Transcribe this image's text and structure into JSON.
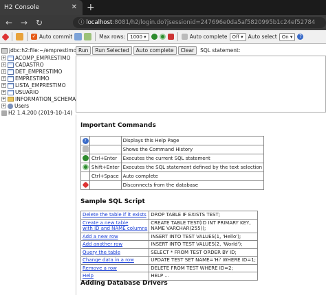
{
  "browser": {
    "tab_title": "H2 Console",
    "tab_close": "✕",
    "new_tab": "+",
    "url_host": "localhost",
    "url_rest": ":8081/h2/login.do?jsessionid=247696e0da5af5820995b1c24ef52784"
  },
  "toolbar": {
    "auto_commit_label": "Auto commit",
    "max_rows_label": "Max rows:",
    "max_rows_value": "1000",
    "auto_complete_label": "Auto complete",
    "auto_complete_value": "Off",
    "auto_select_label": "Auto select",
    "auto_select_value": "On"
  },
  "tree": {
    "connection": "jdbc:h2:file:~/emprestimo",
    "items": [
      {
        "label": "ACOMP_EMPRESTIMO",
        "type": "table"
      },
      {
        "label": "CADASTRO",
        "type": "table"
      },
      {
        "label": "DET_EMPRESTIMO",
        "type": "table"
      },
      {
        "label": "EMPRESTIMO",
        "type": "table"
      },
      {
        "label": "LISTA_EMPRESTIMO",
        "type": "table"
      },
      {
        "label": "USUARIO",
        "type": "table"
      },
      {
        "label": "INFORMATION_SCHEMA",
        "type": "folder"
      },
      {
        "label": "Users",
        "type": "users"
      }
    ],
    "version": "H2 1.4.200 (2019-10-14)"
  },
  "query": {
    "run": "Run",
    "run_selected": "Run Selected",
    "auto_complete": "Auto complete",
    "clear": "Clear",
    "statement_label": "SQL statement:"
  },
  "help": {
    "important_title": "Important Commands",
    "commands": [
      {
        "icon": "help-icon",
        "key": "",
        "desc": "Displays this Help Page"
      },
      {
        "icon": "history-icon",
        "key": "",
        "desc": "Shows the Command History"
      },
      {
        "icon": "run-icon",
        "key": "Ctrl+Enter",
        "desc": "Executes the current SQL statement"
      },
      {
        "icon": "run-selected-icon",
        "key": "Shift+Enter",
        "desc": "Executes the SQL statement defined by the text selection"
      },
      {
        "icon": "",
        "key": "Ctrl+Space",
        "desc": "Auto complete"
      },
      {
        "icon": "disconnect-icon",
        "key": "",
        "desc": "Disconnects from the database"
      }
    ],
    "sample_title": "Sample SQL Script",
    "samples": [
      {
        "left": [
          "Delete the table if it exists"
        ],
        "right": [
          "DROP TABLE IF EXISTS TEST;"
        ]
      },
      {
        "left": [
          "Create a new table",
          "  with ID and NAME columns"
        ],
        "right": [
          "CREATE TABLE TEST(ID INT PRIMARY KEY,",
          "   NAME VARCHAR(255));"
        ]
      },
      {
        "left": [
          "Add a new row"
        ],
        "right": [
          "INSERT INTO TEST VALUES(1, 'Hello');"
        ]
      },
      {
        "left": [
          "Add another row"
        ],
        "right": [
          "INSERT INTO TEST VALUES(2, 'World');"
        ]
      },
      {
        "left": [
          "Query the table"
        ],
        "right": [
          "SELECT * FROM TEST ORDER BY ID;"
        ]
      },
      {
        "left": [
          "Change data in a row"
        ],
        "right": [
          "UPDATE TEST SET NAME='Hi' WHERE ID=1;"
        ]
      },
      {
        "left": [
          "Remove a row"
        ],
        "right": [
          "DELETE FROM TEST WHERE ID=2;"
        ]
      },
      {
        "left": [
          "Help"
        ],
        "right": [
          "HELP ..."
        ]
      }
    ],
    "drivers_title": "Adding Database Drivers"
  }
}
